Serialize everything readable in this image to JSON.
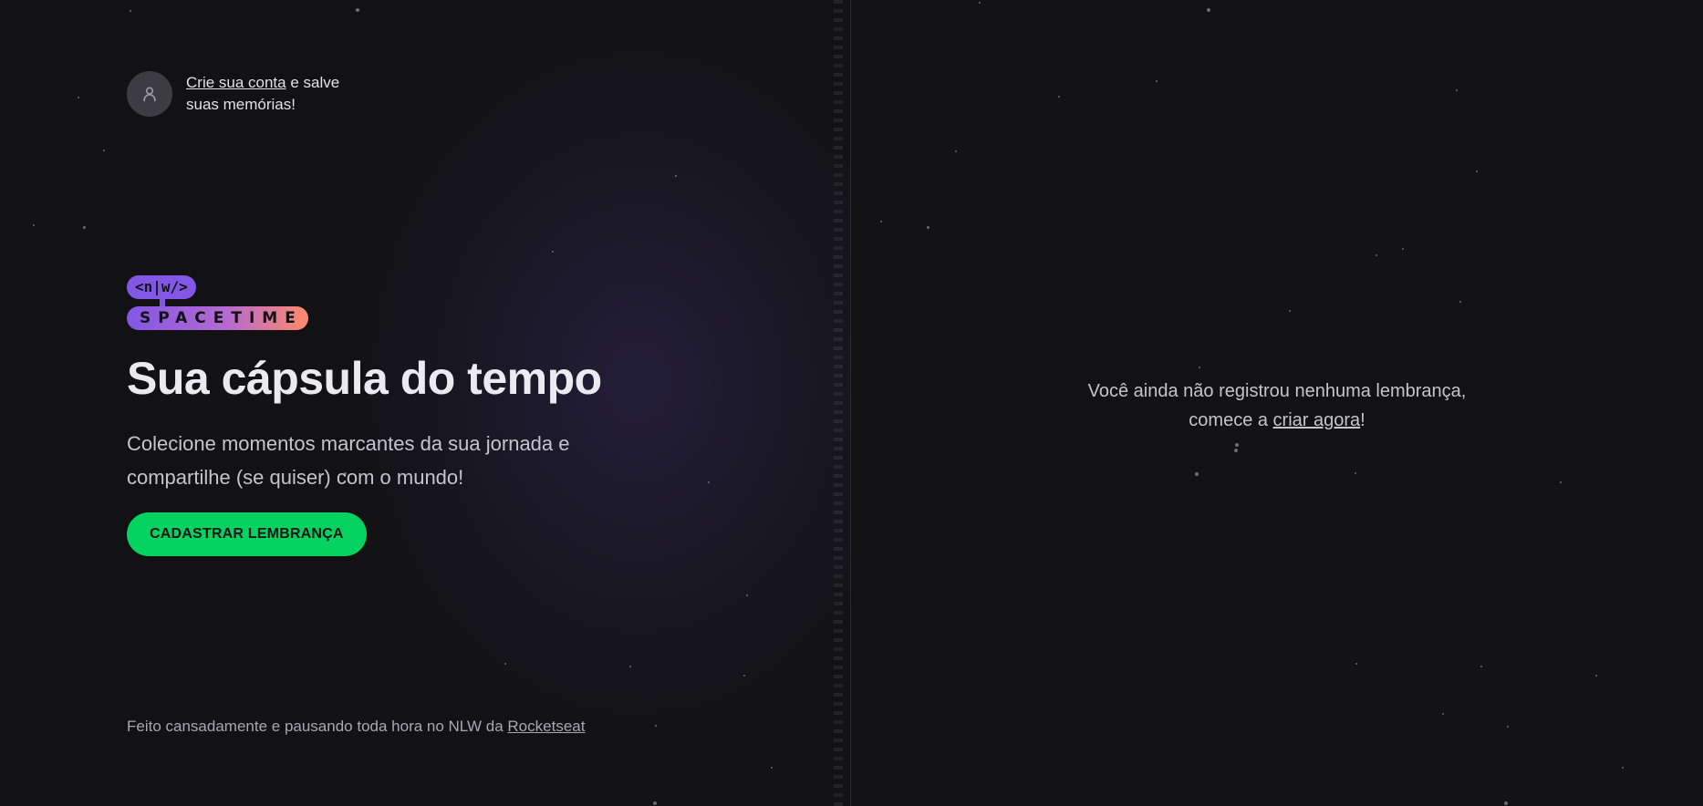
{
  "signin": {
    "link_label": "Crie sua conta",
    "rest_line1": " e salve",
    "rest_line2": "suas memórias!"
  },
  "logo": {
    "badge_top": "<n|w/>",
    "badge_bottom": "SPACETIME"
  },
  "hero": {
    "title": "Sua cápsula do tempo",
    "subtitle": "Colecione momentos marcantes da sua jornada e compartilhe (se quiser) com o mundo!",
    "cta_label": "CADASTRAR LEMBRANÇA"
  },
  "footer": {
    "text": "Feito cansadamente e pausando toda hora no NLW da ",
    "link_label": "Rocketseat"
  },
  "empty_state": {
    "line1": "Você ainda não registrou nenhuma lembrança,",
    "line2_prefix": "comece a ",
    "link_label": "criar agora",
    "line2_suffix": "!"
  },
  "colors": {
    "background": "#121215",
    "accent_green": "#04d361",
    "accent_purple": "#8257e5",
    "accent_orange": "#ff8a6a"
  },
  "icons": {
    "avatar": "user-icon"
  }
}
